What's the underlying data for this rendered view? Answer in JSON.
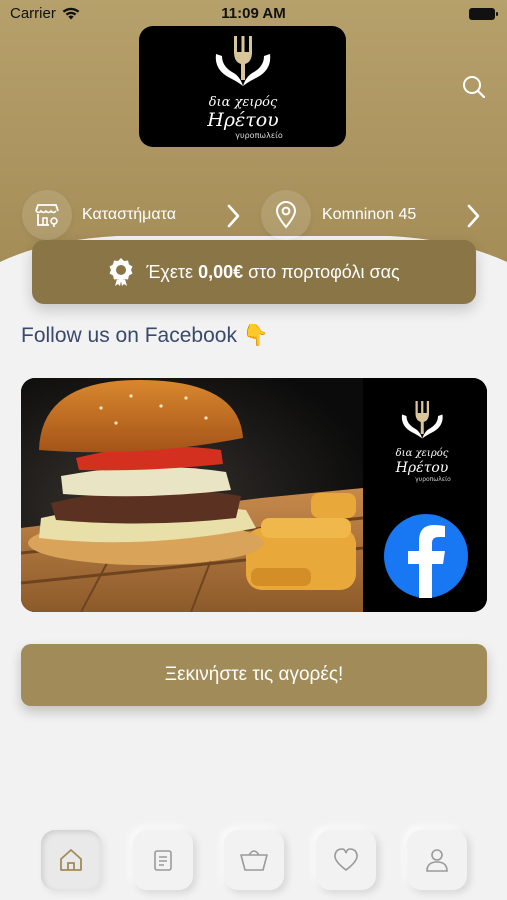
{
  "status_bar": {
    "carrier": "Carrier",
    "time": "11:09 AM"
  },
  "logo": {
    "line1": "δια χειρός",
    "line2": "Ηρέτου",
    "line3": "γυροπωλείο"
  },
  "info_row": {
    "stores_label": "Καταστήματα",
    "address_label": "Komninon 45"
  },
  "wallet": {
    "prefix": "Έχετε",
    "amount": "0,00€",
    "suffix": "στο πορτοφόλι σας"
  },
  "facebook_heading": "Follow us on Facebook",
  "facebook_emoji": "👇",
  "banner": {
    "logo_line1": "δια χειρός",
    "logo_line2": "Ηρέτου",
    "logo_line3": "γυροπωλείο"
  },
  "shop_button_label": "Ξεκινήστε τις αγορές!",
  "colors": {
    "brand_gold": "#a18b58",
    "wallet_bg": "#8a7547",
    "facebook_blue": "#1877f2",
    "heading_navy": "#3a4a6b"
  },
  "tabs": [
    {
      "icon": "home-icon",
      "active": true
    },
    {
      "icon": "orders-icon",
      "active": false
    },
    {
      "icon": "basket-icon",
      "active": false
    },
    {
      "icon": "heart-icon",
      "active": false
    },
    {
      "icon": "profile-icon",
      "active": false
    }
  ]
}
